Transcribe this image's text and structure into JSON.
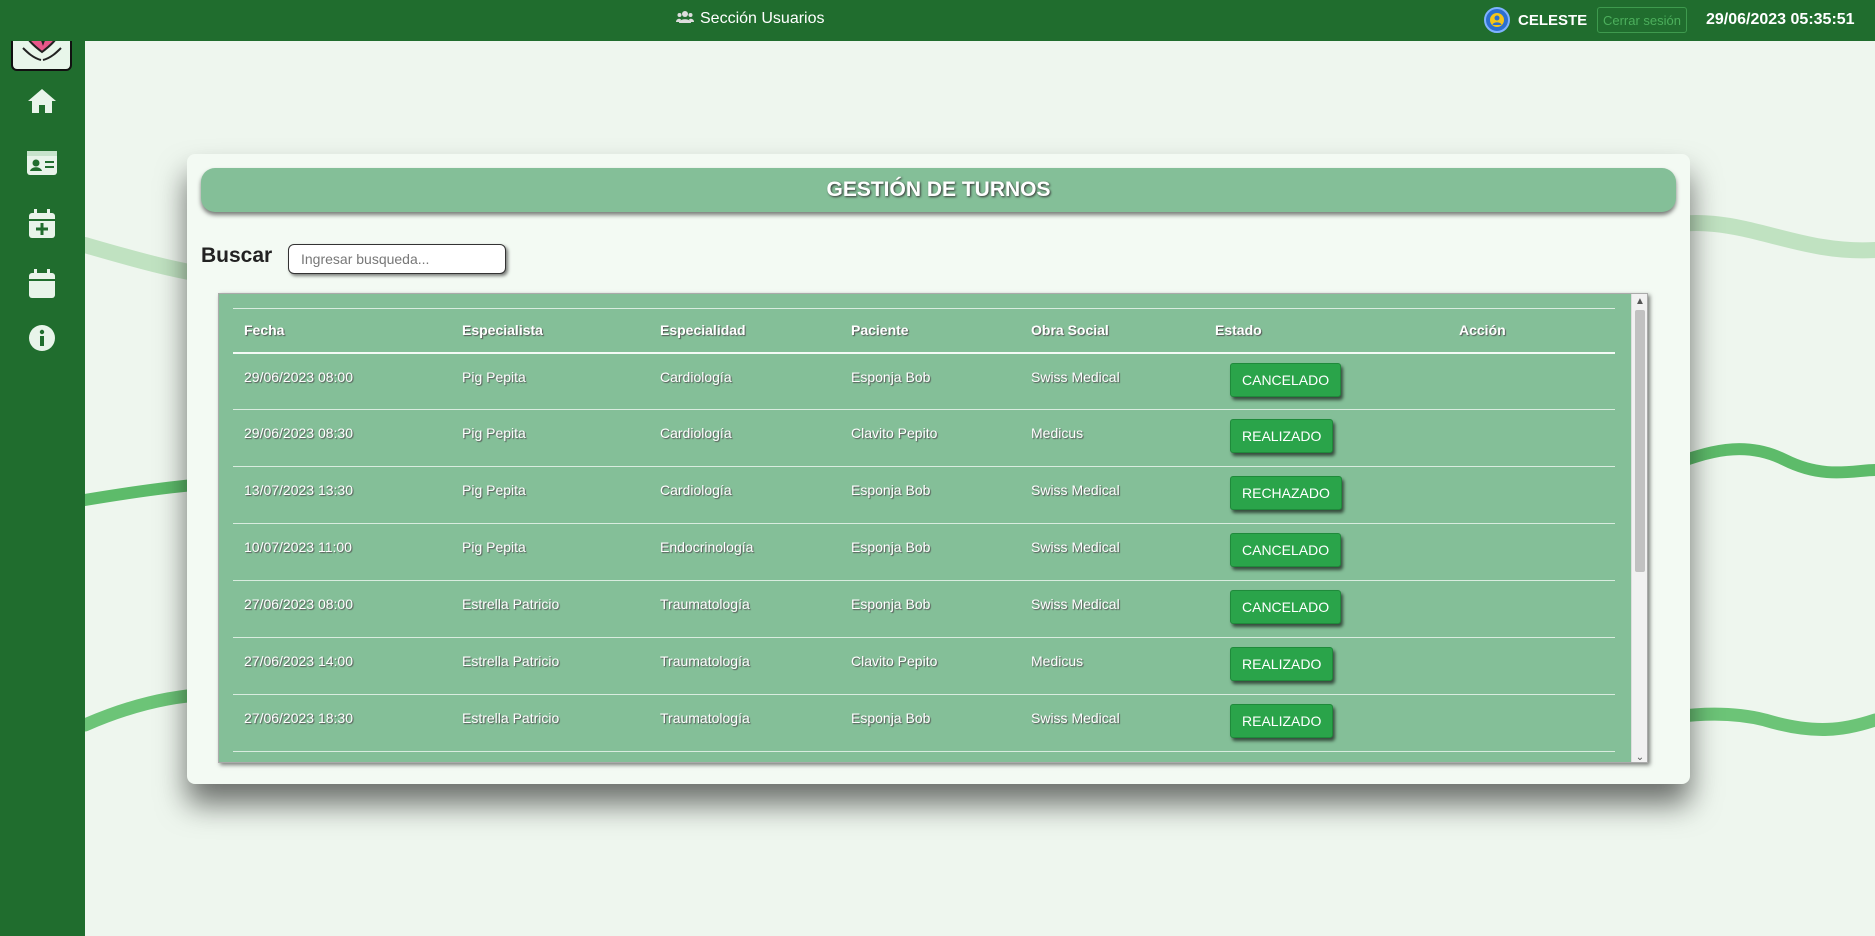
{
  "topbar": {
    "section_label": "Sección Usuarios",
    "section_icon": "users-icon",
    "user_name": "CELESTE",
    "logout_label": "Cerrar sesión",
    "datetime": "29/06/2023 05:35:51"
  },
  "sidebar": {
    "logo_icon": "heart-hands-icon",
    "items": [
      {
        "icon": "home-icon"
      },
      {
        "icon": "id-card-icon"
      },
      {
        "icon": "calendar-plus-icon"
      },
      {
        "icon": "calendar-icon"
      },
      {
        "icon": "info-icon"
      }
    ]
  },
  "card": {
    "title": "GESTIÓN DE TURNOS",
    "search_label": "Buscar",
    "search_placeholder": "Ingresar busqueda...",
    "search_value": ""
  },
  "table": {
    "headers": [
      "Fecha",
      "Especialista",
      "Especialidad",
      "Paciente",
      "Obra Social",
      "Estado",
      "Acción"
    ],
    "rows": [
      {
        "fecha": "29/06/2023 08:00",
        "especialista": "Pig Pepita",
        "especialidad": "Cardiología",
        "paciente": "Esponja Bob",
        "obra_social": "Swiss Medical",
        "estado": "CANCELADO"
      },
      {
        "fecha": "29/06/2023 08:30",
        "especialista": "Pig Pepita",
        "especialidad": "Cardiología",
        "paciente": "Clavito Pepito",
        "obra_social": "Medicus",
        "estado": "REALIZADO"
      },
      {
        "fecha": "13/07/2023 13:30",
        "especialista": "Pig Pepita",
        "especialidad": "Cardiología",
        "paciente": "Esponja Bob",
        "obra_social": "Swiss Medical",
        "estado": "RECHAZADO"
      },
      {
        "fecha": "10/07/2023 11:00",
        "especialista": "Pig Pepita",
        "especialidad": "Endocrinología",
        "paciente": "Esponja Bob",
        "obra_social": "Swiss Medical",
        "estado": "CANCELADO"
      },
      {
        "fecha": "27/06/2023 08:00",
        "especialista": "Estrella Patricio",
        "especialidad": "Traumatología",
        "paciente": "Esponja Bob",
        "obra_social": "Swiss Medical",
        "estado": "CANCELADO"
      },
      {
        "fecha": "27/06/2023 14:00",
        "especialista": "Estrella Patricio",
        "especialidad": "Traumatología",
        "paciente": "Clavito Pepito",
        "obra_social": "Medicus",
        "estado": "REALIZADO"
      },
      {
        "fecha": "27/06/2023 18:30",
        "especialista": "Estrella Patricio",
        "especialidad": "Traumatología",
        "paciente": "Esponja Bob",
        "obra_social": "Swiss Medical",
        "estado": "REALIZADO"
      }
    ]
  },
  "colors": {
    "sidebar": "#206d2e",
    "table_bg": "#84bf98",
    "status_button": "#2aa44a",
    "page_bg": "#eef6ee"
  }
}
